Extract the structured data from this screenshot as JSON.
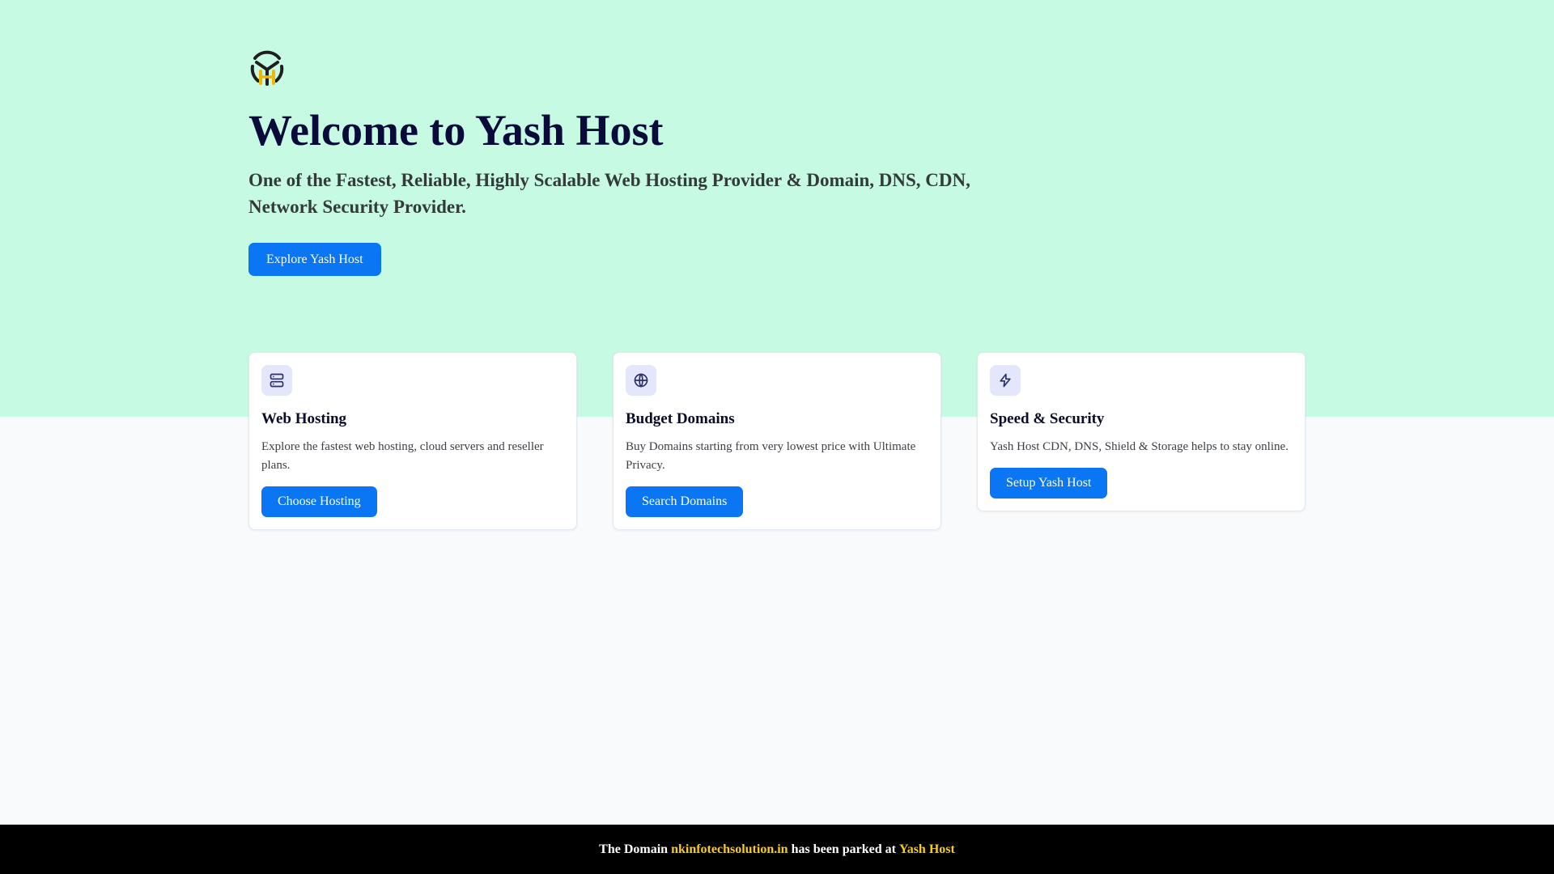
{
  "colors": {
    "hero_bg": "#c6fae2",
    "page_bg": "#f8fafc",
    "primary": "#0a76f3",
    "logo_dark": "#1f1f1f",
    "logo_accent": "#f2b705",
    "footer_bg": "#000000",
    "footer_highlight": "#facc15"
  },
  "hero": {
    "logo_icon": "yash-host-logo-icon",
    "title": "Welcome to Yash Host",
    "subtitle": "One of the Fastest, Reliable, Highly Scalable Web Hosting Provider & Domain, DNS, CDN, Network Security Provider.",
    "cta_label": "Explore Yash Host"
  },
  "cards": [
    {
      "icon": "server-icon",
      "title": "Web Hosting",
      "description": "Explore the fastest web hosting, cloud servers and reseller plans.",
      "button_label": "Choose Hosting"
    },
    {
      "icon": "globe-icon",
      "title": "Budget Domains",
      "description": "Buy Domains starting from very lowest price with Ultimate Privacy.",
      "button_label": "Search Domains"
    },
    {
      "icon": "lightning-icon",
      "title": "Speed & Security",
      "description": "Yash Host CDN, DNS, Shield & Storage helps to stay online.",
      "button_label": "Setup Yash Host"
    }
  ],
  "footer": {
    "prefix": "The Domain",
    "domain": "nkinfotechsolution.in",
    "middle": "has been parked at",
    "brand": "Yash Host"
  }
}
